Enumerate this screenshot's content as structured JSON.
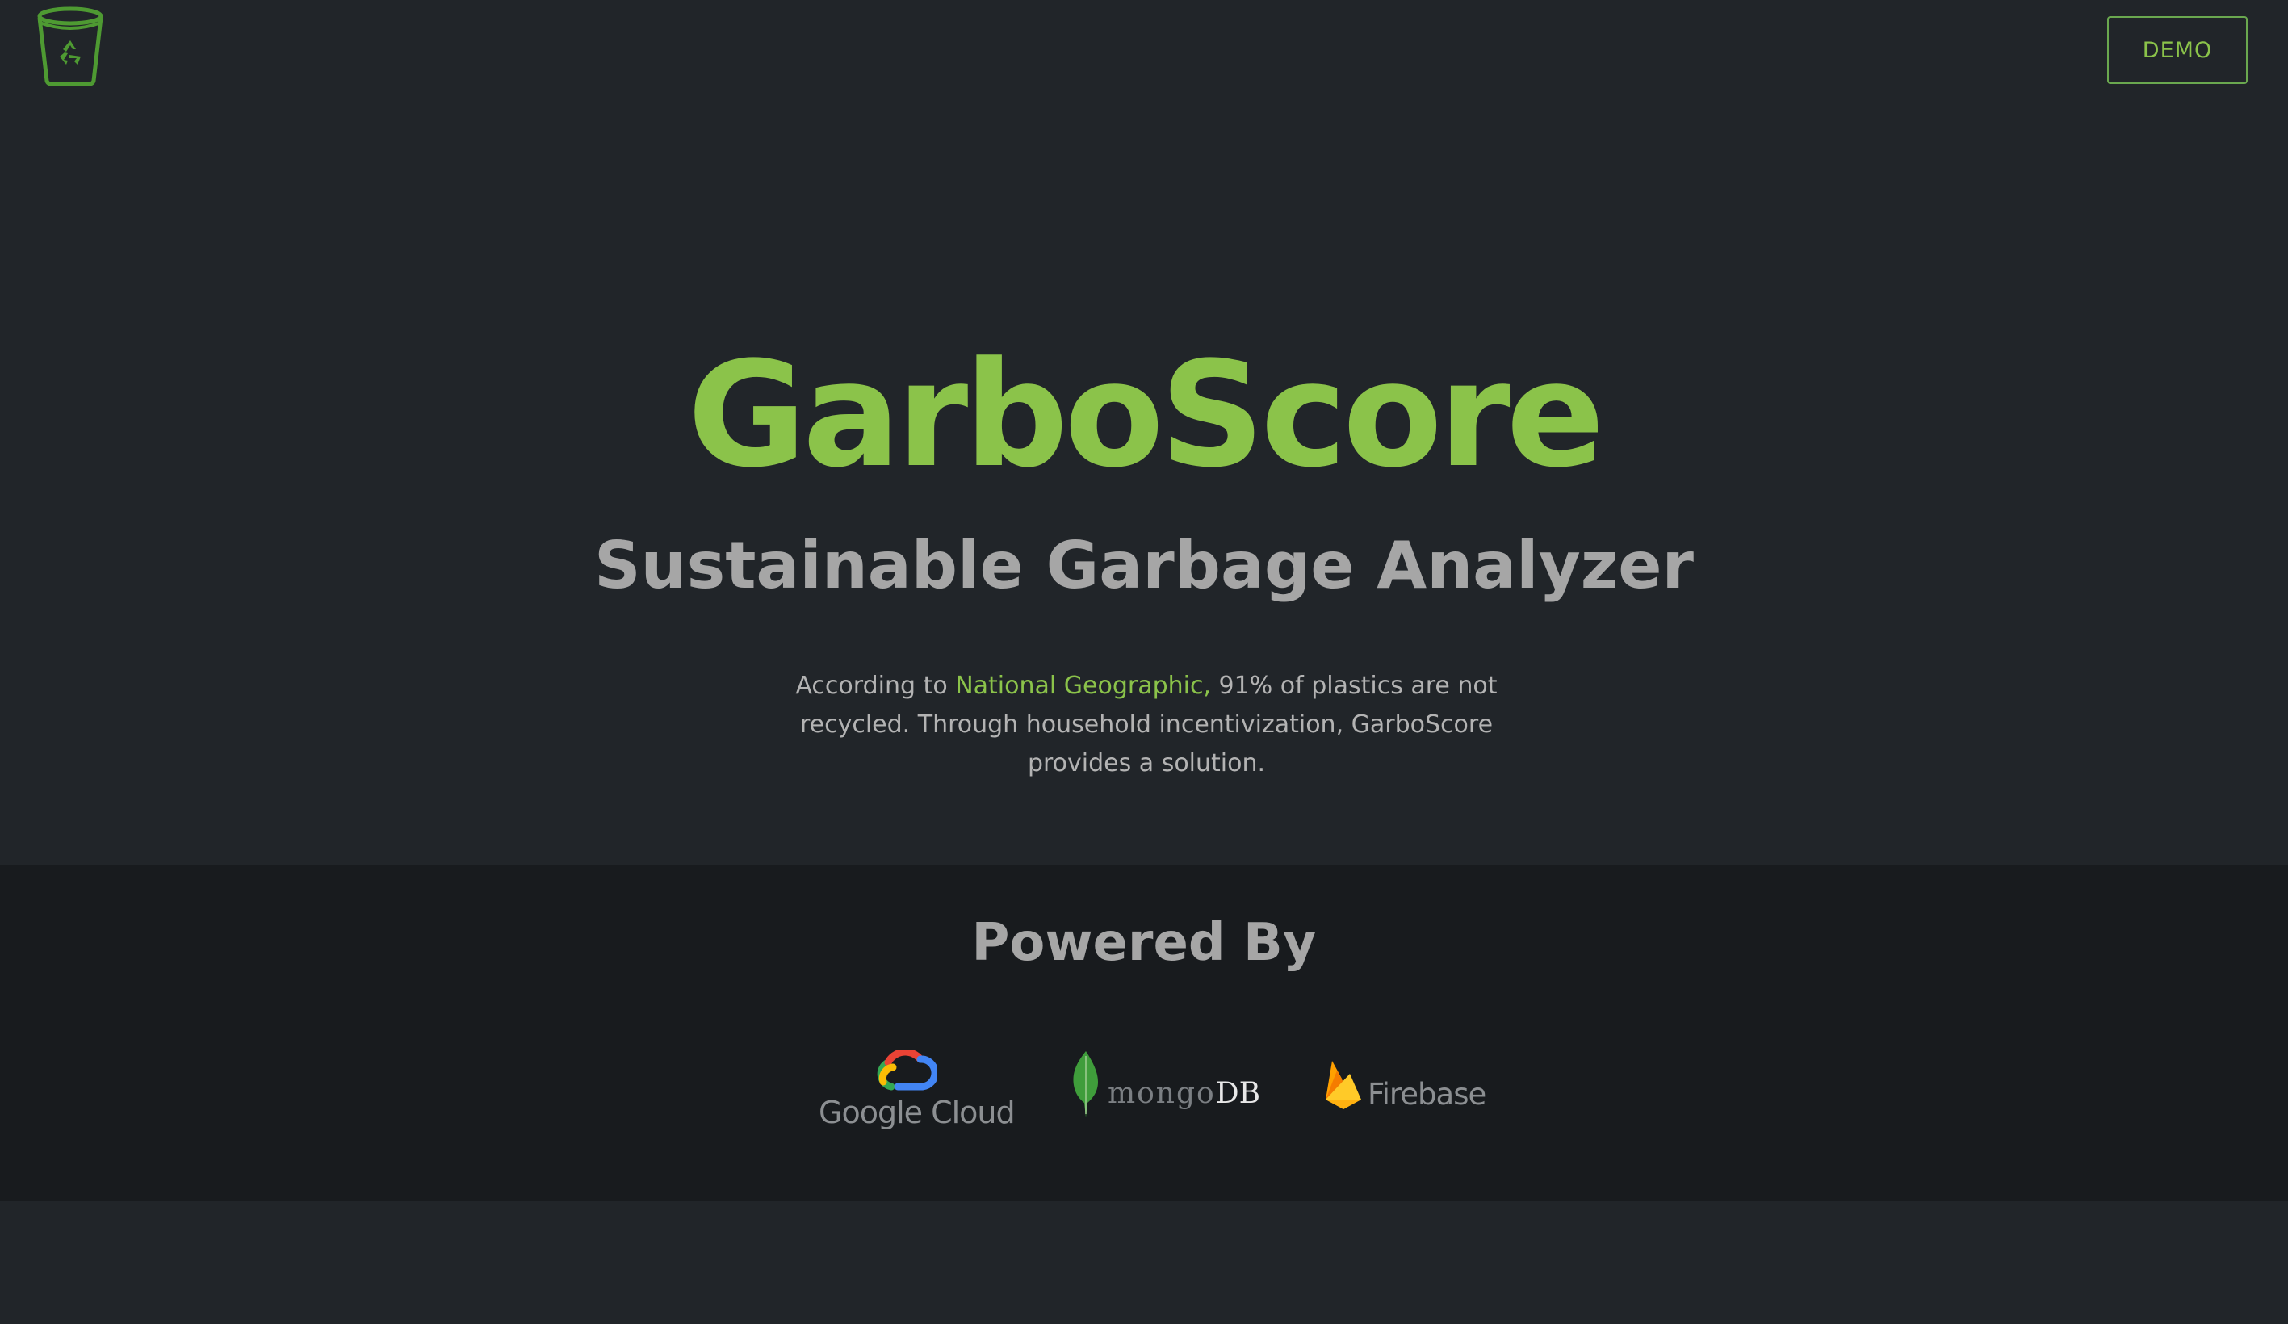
{
  "header": {
    "logo_icon": "recycle-bin-icon",
    "demo_label": "DEMO"
  },
  "hero": {
    "title": "GarboScore",
    "subtitle": "Sustainable Garbage Analyzer",
    "description": {
      "prefix": "According to ",
      "link_text": "National Geographic,",
      "suffix": " 91% of plastics are not recycled. Through household incentivization, GarboScore provides a solution."
    }
  },
  "powered_by": {
    "title": "Powered By",
    "sponsors": [
      {
        "name": "Google Cloud",
        "icon": "google-cloud-icon"
      },
      {
        "name_mongo": "mongo",
        "name_db": "DB",
        "icon": "mongodb-leaf-icon"
      },
      {
        "name": "Firebase",
        "icon": "firebase-flame-icon"
      }
    ]
  },
  "colors": {
    "background": "#212529",
    "section_background": "#181b1e",
    "accent": "#8bc34a",
    "muted_text": "#a6a6a6"
  }
}
